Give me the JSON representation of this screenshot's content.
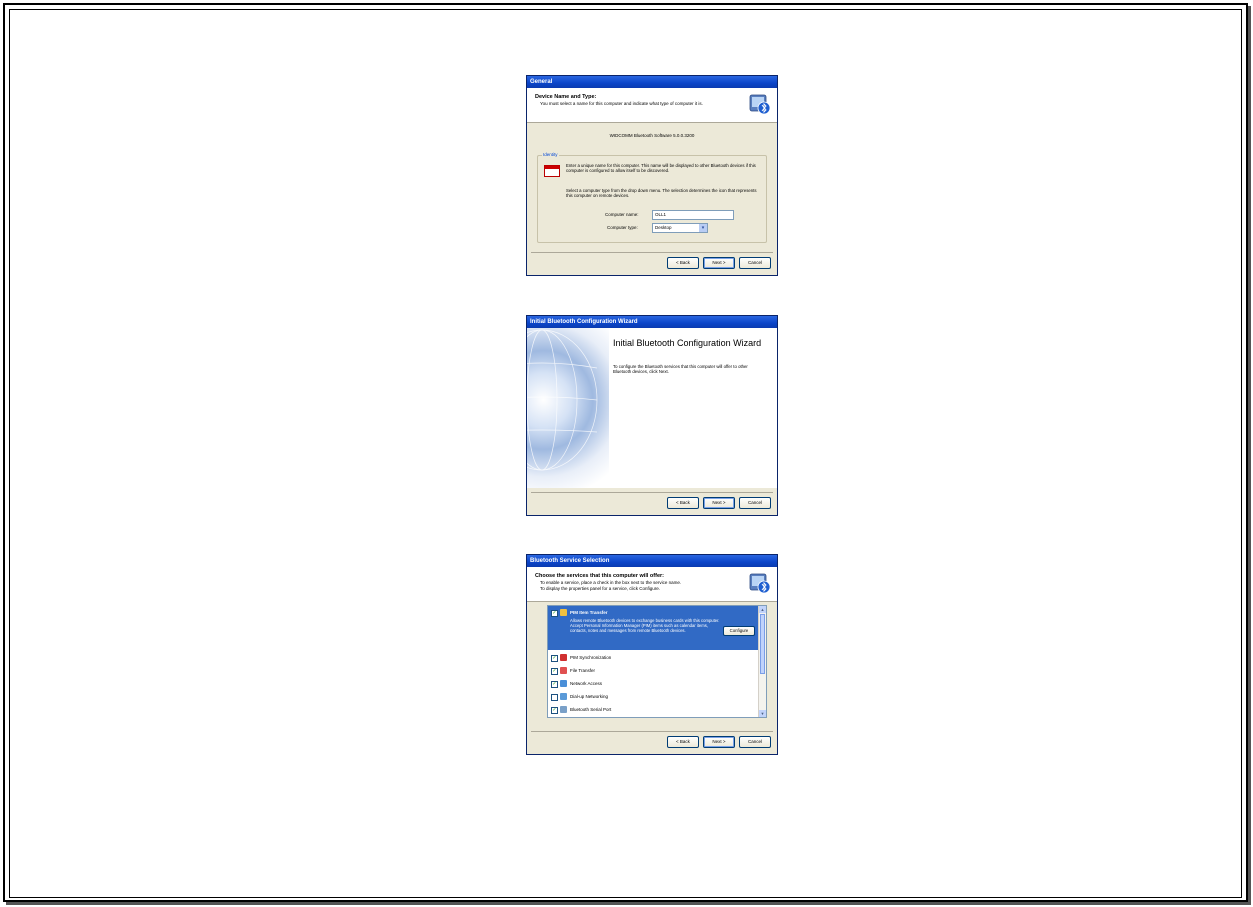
{
  "windows": [
    {
      "title": "General",
      "header_title": "Device Name and Type:",
      "header_subtitle": "You must select a name for this computer and indicate what type of computer it is.",
      "product": "WIDCOMM Bluetooth Software 5.0.0.3200",
      "group_label": "Identity",
      "identity_text": "Enter a unique name for this computer. This name will be displayed to other Bluetooth devices if this computer is configured to allow itself to be discovered.",
      "type_text": "Select a computer type from the drop down menu. The selection determines the icon that represents this computer on remote devices.",
      "computer_name_label": "Computer name:",
      "computer_name_value": "OLL1",
      "computer_type_label": "Computer type:",
      "computer_type_value": "Desktop",
      "buttons": {
        "back": "< Back",
        "next": "Next >",
        "cancel": "Cancel"
      }
    },
    {
      "title": "Initial Bluetooth Configuration Wizard",
      "wizard_title": "Initial Bluetooth Configuration Wizard",
      "wizard_text": "To configure the Bluetooth services that this computer will offer to other Bluetooth devices, click Next.",
      "buttons": {
        "back": "< Back",
        "next": "Next >",
        "cancel": "Cancel"
      }
    },
    {
      "title": "Bluetooth Service Selection",
      "header_title": "Choose the services that this computer will offer:",
      "header_subtitle_1": "To enable a service, place a check in the box next to the service name.",
      "header_subtitle_2": "To display the properties panel for a service, click Configure.",
      "services": [
        {
          "label": "PIM Item Transfer",
          "checked": true,
          "icon": "pim-transfer-icon"
        },
        {
          "label": "PIM Synchronization",
          "checked": true,
          "icon": "pim-sync-icon"
        },
        {
          "label": "File Transfer",
          "checked": true,
          "icon": "file-transfer-icon"
        },
        {
          "label": "Network Access",
          "checked": true,
          "icon": "network-access-icon"
        },
        {
          "label": "Dial-up Networking",
          "checked": false,
          "icon": "dialup-icon"
        },
        {
          "label": "Bluetooth Serial Port",
          "checked": true,
          "icon": "serial-port-icon"
        }
      ],
      "selected_desc": "Allows remote Bluetooth devices to exchange business cards with this computer. Accept Personal Information Manager (PIM) items such as calendar items, contacts, notes and messages from remote Bluetooth devices.",
      "configure_label": "Configure",
      "buttons": {
        "back": "< Back",
        "next": "Next >",
        "cancel": "Cancel"
      }
    }
  ],
  "colors": {
    "titlebar": "#0b45c9",
    "dialog_bg": "#ece9d8",
    "selection": "#316ac5"
  }
}
